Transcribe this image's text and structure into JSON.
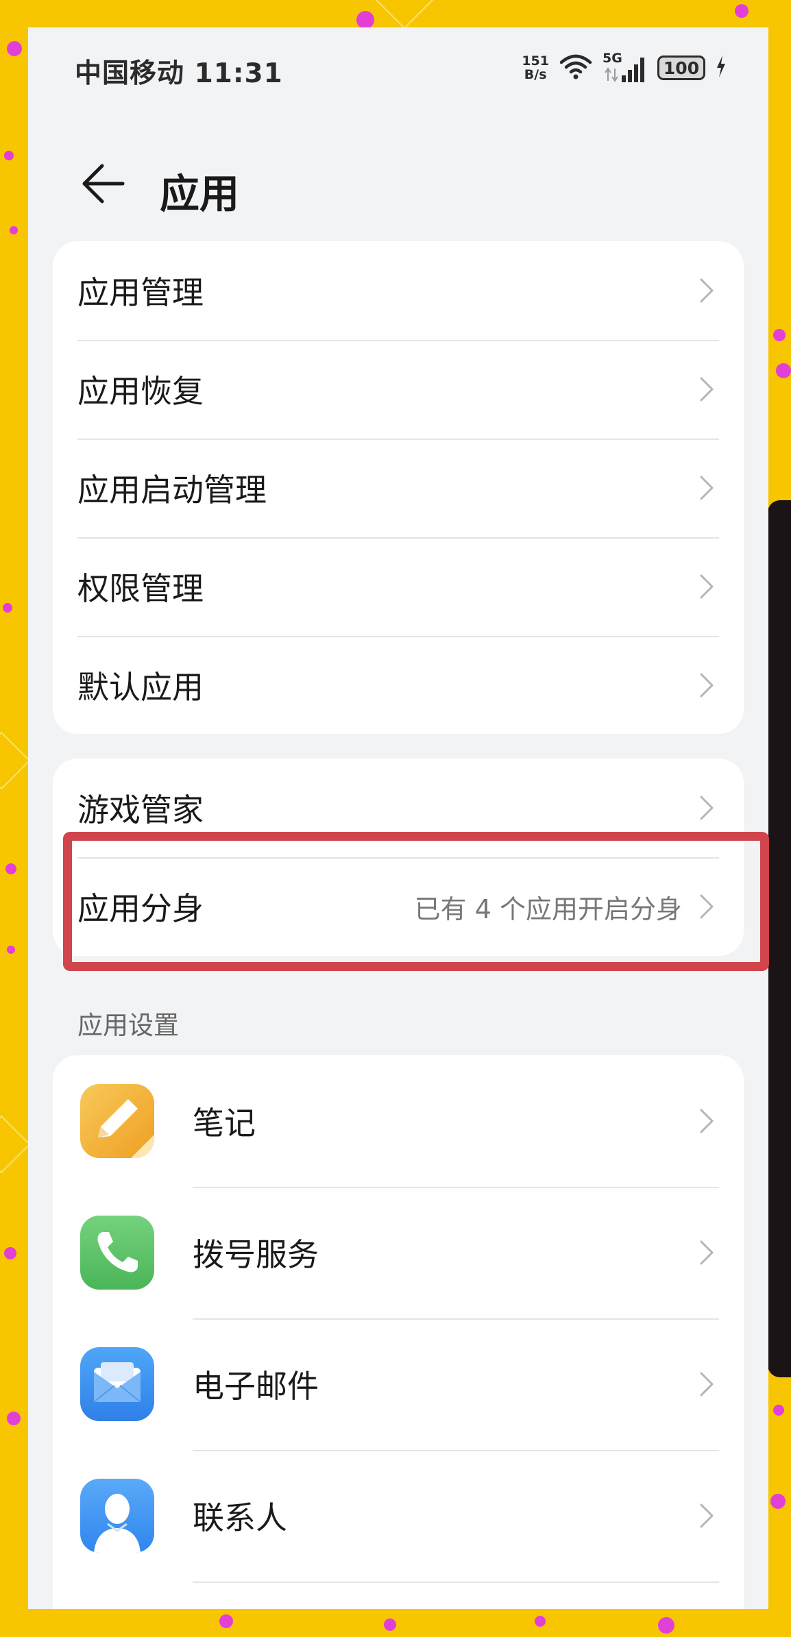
{
  "status_bar": {
    "carrier_time": "中国移动 11:31",
    "net_speed_value": "151",
    "net_speed_unit": "B/s",
    "network_gen": "5G",
    "battery": "100"
  },
  "header": {
    "title": "应用"
  },
  "group1": {
    "items": [
      {
        "label": "应用管理"
      },
      {
        "label": "应用恢复"
      },
      {
        "label": "应用启动管理"
      },
      {
        "label": "权限管理"
      },
      {
        "label": "默认应用"
      }
    ]
  },
  "group2": {
    "items": [
      {
        "label": "游戏管家",
        "value": ""
      },
      {
        "label": "应用分身",
        "value": "已有 4 个应用开启分身"
      }
    ]
  },
  "app_settings": {
    "section_title": "应用设置",
    "apps": [
      {
        "label": "笔记",
        "icon": "notes-icon"
      },
      {
        "label": "拨号服务",
        "icon": "phone-icon"
      },
      {
        "label": "电子邮件",
        "icon": "email-icon"
      },
      {
        "label": "联系人",
        "icon": "contacts-icon"
      }
    ]
  },
  "colors": {
    "background": "#f7c600",
    "screen": "#f1f3f5",
    "card": "#ffffff",
    "highlight": "#d0444c",
    "notes": "#f2b43a",
    "phone": "#5cc66a",
    "email": "#3a8ff0",
    "contacts": "#3f95f5"
  }
}
